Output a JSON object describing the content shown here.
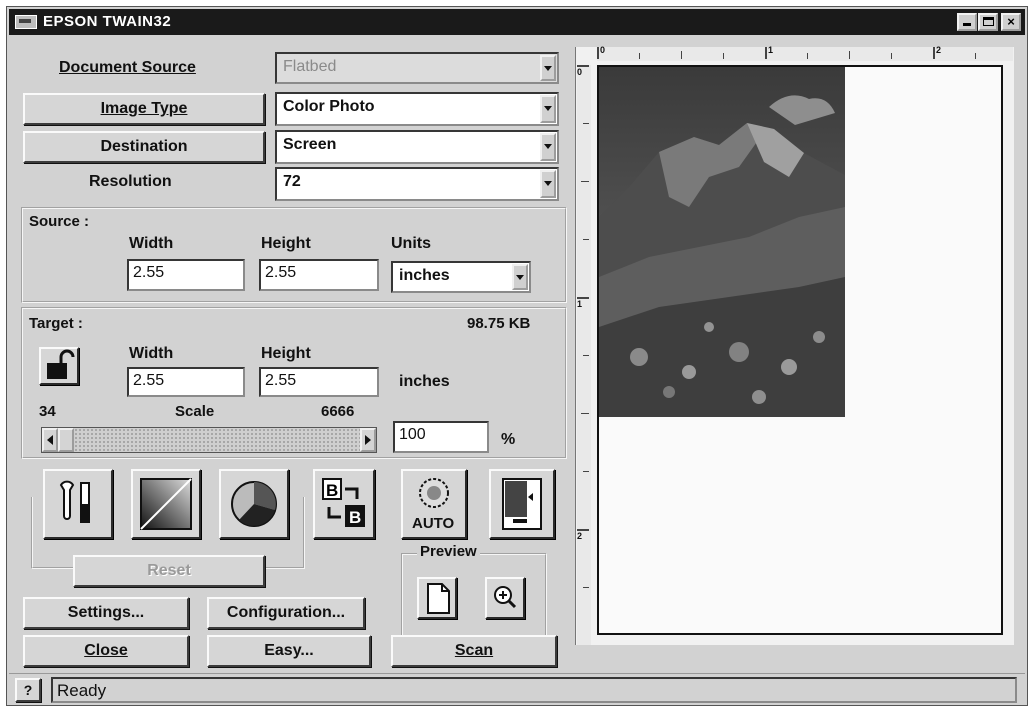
{
  "window": {
    "title": "EPSON TWAIN32"
  },
  "rows": {
    "document_source": {
      "label": "Document Source",
      "value": "Flatbed"
    },
    "image_type": {
      "label": "Image Type",
      "value": "Color Photo"
    },
    "destination": {
      "label": "Destination",
      "value": "Screen"
    },
    "resolution": {
      "label": "Resolution",
      "value": "72"
    }
  },
  "source": {
    "title": "Source :",
    "width_label": "Width",
    "width_value": "2.55",
    "height_label": "Height",
    "height_value": "2.55",
    "units_label": "Units",
    "units_value": "inches"
  },
  "target": {
    "title": "Target :",
    "size": "98.75 KB",
    "width_label": "Width",
    "width_value": "2.55",
    "height_label": "Height",
    "height_value": "2.55",
    "units": "inches",
    "scale_min": "34",
    "scale_label": "Scale",
    "scale_max": "6666",
    "scale_value": "100",
    "percent": "%"
  },
  "tools": {
    "reset_label": "Reset",
    "auto_label": "AUTO",
    "preview_label": "Preview"
  },
  "buttons": {
    "settings": "Settings...",
    "configuration": "Configuration...",
    "close": "Close",
    "easy": "Easy...",
    "scan": "Scan"
  },
  "ruler": {
    "top": [
      "0",
      "1",
      "2"
    ],
    "left": [
      "0",
      "1",
      "2"
    ]
  },
  "status": {
    "help": "?",
    "text": "Ready"
  }
}
